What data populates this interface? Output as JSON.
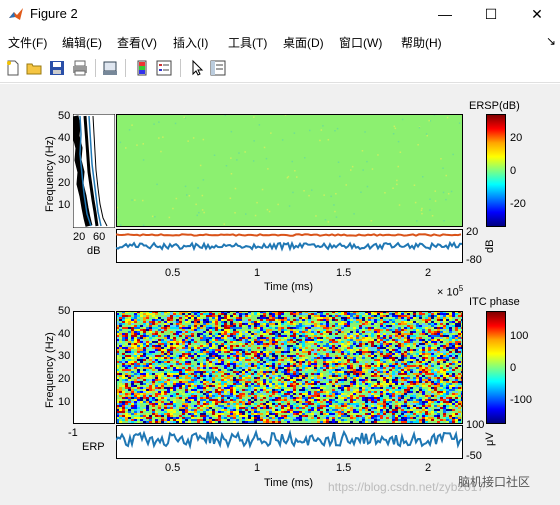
{
  "window": {
    "title": "Figure 2",
    "minimize": "—",
    "maximize": "☐",
    "close": "✕"
  },
  "menu": [
    "文件(F)",
    "编辑(E)",
    "查看(V)",
    "插入(I)",
    "工具(T)",
    "桌面(D)",
    "窗口(W)",
    "帮助(H)"
  ],
  "menu_arrow": "↘",
  "toolbar": {
    "icons": [
      "new-figure-icon",
      "open-file-icon",
      "save-icon",
      "print-icon",
      "print-preview-icon",
      "colorbar-icon",
      "legend-icon",
      "pointer-icon",
      "property-editor-icon"
    ]
  },
  "ersp": {
    "ylabel": "Frequency (Hz)",
    "yticks": [
      "50",
      "40",
      "30",
      "20",
      "10"
    ],
    "side_xticks": [
      "20",
      "60"
    ],
    "side_xlabel": "dB",
    "colorbar_title": "ERSP(dB)",
    "colorbar_ticks": [
      "20",
      "0",
      "-20"
    ],
    "trace_ticks_right": [
      "20",
      "-80"
    ],
    "trace_label": "dB",
    "xticks": [
      "0.5",
      "1",
      "1.5",
      "2"
    ],
    "xlabel": "Time (ms)",
    "x_exponent": "× 10",
    "x_exponent_power": "5"
  },
  "itc": {
    "ylabel": "Frequency (Hz)",
    "yticks": [
      "50",
      "40",
      "30",
      "20",
      "10"
    ],
    "colorbar_title": "ITC phase",
    "colorbar_ticks": [
      "100",
      "0",
      "-100"
    ],
    "erp_left_tick": "-1",
    "erp_label": "ERP",
    "erp_ticks_right": [
      "100",
      "-50"
    ],
    "erp_unit": "μV",
    "xticks": [
      "0.5",
      "1",
      "1.5",
      "2"
    ],
    "xlabel": "Time (ms)"
  },
  "watermark": "https://blog.csdn.net/zyb2017",
  "watermark_badge": "脑机接口社区",
  "colors": {
    "green": "#8cf070",
    "blue_line": "#1f77b4",
    "orange_line": "#d95319"
  }
}
